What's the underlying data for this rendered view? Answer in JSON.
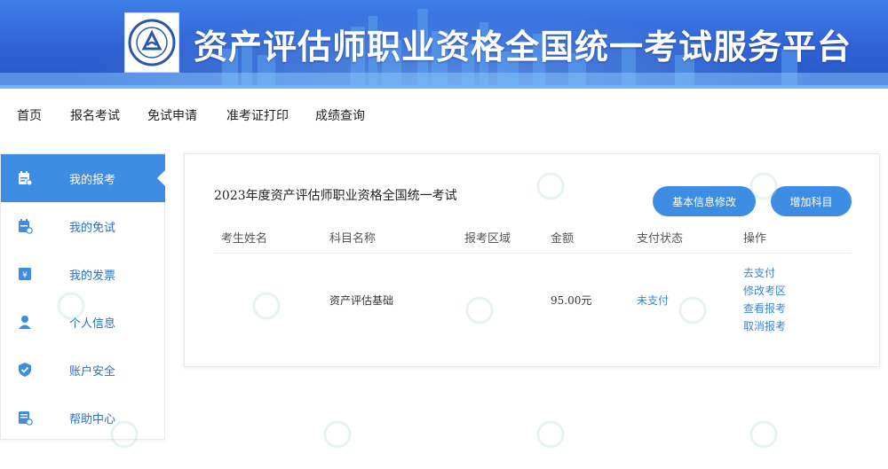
{
  "banner": {
    "title": "资产评估师职业资格全国统一考试服务平台",
    "logo_icon": "association-seal-logo"
  },
  "nav": {
    "items": [
      {
        "label": "首页"
      },
      {
        "label": "报名考试"
      },
      {
        "label": "免试申请"
      },
      {
        "label": "准考证打印"
      },
      {
        "label": "成绩查询"
      }
    ]
  },
  "sidebar": {
    "items": [
      {
        "label": "我的报考",
        "icon": "calendar-edit-icon",
        "active": true
      },
      {
        "label": "我的免试",
        "icon": "calendar-check-icon",
        "active": false
      },
      {
        "label": "我的发票",
        "icon": "invoice-icon",
        "active": false
      },
      {
        "label": "个人信息",
        "icon": "user-icon",
        "active": false
      },
      {
        "label": "账户安全",
        "icon": "shield-check-icon",
        "active": false
      },
      {
        "label": "帮助中心",
        "icon": "help-doc-icon",
        "active": false
      }
    ]
  },
  "main": {
    "title": "2023年度资产评估师职业资格全国统一考试",
    "edit_button": "基本信息修改",
    "add_button": "增加科目",
    "table": {
      "headers": [
        "考生姓名",
        "科目名称",
        "报考区域",
        "金额",
        "支付状态",
        "操作"
      ],
      "rows": [
        {
          "name": "",
          "subject": "资产评估基础",
          "region": "",
          "amount": "95.00元",
          "status": "未支付",
          "actions": [
            "去支付",
            "修改考区",
            "查看报考",
            "取消报考"
          ]
        }
      ]
    }
  },
  "colors": {
    "accent": "#3e8de5",
    "link": "#3a86d9",
    "banner": "#2f62d3"
  }
}
